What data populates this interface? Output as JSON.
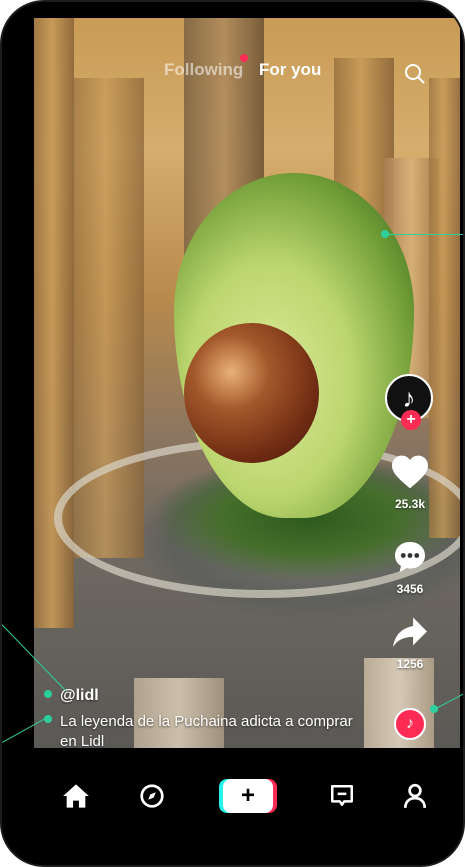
{
  "top_tabs": {
    "following_label": "Following",
    "for_you_label": "For you"
  },
  "post": {
    "username": "@lidl",
    "caption": "La leyenda de la Puchaina adicta a comprar en Lidl",
    "likes": "25.3k",
    "comments": "3456",
    "shares": "1256"
  },
  "icons": {
    "search": "search-icon",
    "avatar": "tiktok-logo-icon",
    "follow": "plus-icon",
    "like": "heart-icon",
    "comment": "comment-icon",
    "share": "share-arrow-icon",
    "music": "music-disc-icon",
    "home": "home-icon",
    "discover": "compass-icon",
    "create": "plus-icon",
    "inbox": "inbox-icon",
    "profile": "profile-icon"
  },
  "colors": {
    "brand_red": "#fe2c55",
    "brand_cyan": "#25f4ee",
    "annotation": "#2ecf9f"
  }
}
